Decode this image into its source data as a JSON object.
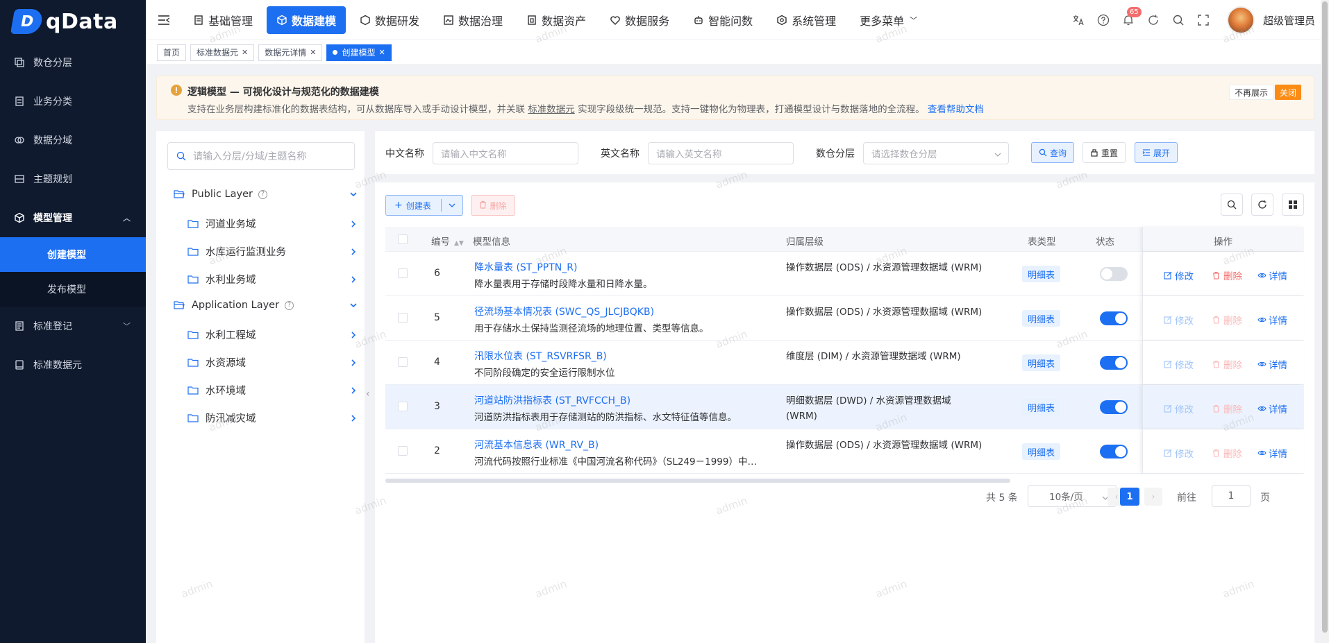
{
  "brand": {
    "logo_letter": "D",
    "name": "qData"
  },
  "sidebar": {
    "items": [
      {
        "label": "数仓分层",
        "icon": "layers-icon"
      },
      {
        "label": "业务分类",
        "icon": "list-icon"
      },
      {
        "label": "数据分域",
        "icon": "domain-icon"
      },
      {
        "label": "主题规划",
        "icon": "theme-icon"
      },
      {
        "label": "模型管理",
        "icon": "cube-icon",
        "expanded": true
      },
      {
        "label": "标准登记",
        "icon": "register-icon"
      },
      {
        "label": "标准数据元",
        "icon": "book-icon"
      }
    ],
    "subitems": [
      {
        "label": "创建模型",
        "active": true
      },
      {
        "label": "发布模型",
        "active": false
      }
    ]
  },
  "topnav": {
    "items": [
      {
        "label": "基础管理",
        "active": false
      },
      {
        "label": "数据建模",
        "active": true
      },
      {
        "label": "数据研发",
        "active": false
      },
      {
        "label": "数据治理",
        "active": false
      },
      {
        "label": "数据资产",
        "active": false
      },
      {
        "label": "数据服务",
        "active": false
      },
      {
        "label": "智能问数",
        "active": false
      },
      {
        "label": "系统管理",
        "active": false
      }
    ],
    "more_label": "更多菜单",
    "notification_count": "65",
    "username": "超级管理员"
  },
  "tabs": [
    {
      "label": "首页",
      "closable": false,
      "active": false
    },
    {
      "label": "标准数据元",
      "closable": true,
      "active": false
    },
    {
      "label": "数据元详情",
      "closable": true,
      "active": false
    },
    {
      "label": "创建模型",
      "closable": true,
      "active": true
    }
  ],
  "alert": {
    "title": "逻辑模型 — 可视化设计与规范化的数据建模",
    "desc_part1": "支持在业务层构建标准化的数据表结构，可从数据库导入或手动设计模型，并关联",
    "desc_link": "标准数据元",
    "desc_part2": "实现字段级统一规范。支持一键物化为物理表，打通模型设计与数据落地的全流程。",
    "help_link": "查看帮助文档",
    "hide_label": "不再展示",
    "close_label": "关闭"
  },
  "tree": {
    "search_placeholder": "请输入分层/分域/主题名称",
    "groups": [
      {
        "label": "Public Layer",
        "children": [
          "河道业务域",
          "水库运行监测业务",
          "水利业务域"
        ]
      },
      {
        "label": "Application Layer",
        "children": [
          "水利工程域",
          "水资源域",
          "水环境域",
          "防汛减灾域"
        ]
      }
    ]
  },
  "filters": {
    "cn_name_label": "中文名称",
    "cn_name_placeholder": "请输入中文名称",
    "en_name_label": "英文名称",
    "en_name_placeholder": "请输入英文名称",
    "layer_label": "数仓分层",
    "layer_placeholder": "请选择数仓分层",
    "query_label": "查询",
    "reset_label": "重置",
    "expand_label": "展开"
  },
  "toolbar": {
    "create_label": "创建表",
    "delete_label": "删除"
  },
  "table": {
    "headers": {
      "id": "编号",
      "info": "模型信息",
      "layer": "归属层级",
      "type": "表类型",
      "status": "状态",
      "ops": "操作"
    },
    "ops": {
      "edit": "修改",
      "delete": "删除",
      "detail": "详情"
    },
    "rows": [
      {
        "id": "6",
        "name": "降水量表 (ST_PPTN_R)",
        "desc": "降水量表用于存储时段降水量和日降水量。",
        "layer": "操作数据层 (ODS) / 水资源管理数据域 (WRM)",
        "type": "明细表",
        "status": false,
        "highlight": false
      },
      {
        "id": "5",
        "name": "径流场基本情况表 (SWC_QS_JLCJBQKB)",
        "desc": "用于存储水土保持监测径流场的地理位置、类型等信息。",
        "layer": "操作数据层 (ODS) / 水资源管理数据域 (WRM)",
        "type": "明细表",
        "status": true,
        "highlight": false
      },
      {
        "id": "4",
        "name": "汛限水位表 (ST_RSVRFSR_B)",
        "desc": "不同阶段确定的安全运行限制水位",
        "layer": "维度层 (DIM) / 水资源管理数据域 (WRM)",
        "type": "明细表",
        "status": true,
        "highlight": false
      },
      {
        "id": "3",
        "name": "河道站防洪指标表 (ST_RVFCCH_B)",
        "desc": "河道防洪指标表用于存储测站的防洪指标、水文特征值等信息。",
        "layer": "明细数据层 (DWD) / 水资源管理数据域 (WRM)",
        "type": "明细表",
        "status": true,
        "highlight": true
      },
      {
        "id": "2",
        "name": "河流基本信息表 (WR_RV_B)",
        "desc": "河流代码按照行业标准《中国河流名称代码》（SL249－1999）中…",
        "layer": "操作数据层 (ODS) / 水资源管理数据域 (WRM)",
        "type": "明细表",
        "status": true,
        "highlight": false
      }
    ]
  },
  "pagination": {
    "total_label": "共 5 条",
    "page_size": "10条/页",
    "current": "1",
    "goto_label": "前往",
    "goto_value": "1",
    "page_label": "页"
  },
  "watermark": "admin",
  "colors": {
    "primary": "#1d6ff2",
    "sidebar_bg": "#0f1a2e",
    "danger": "#f56c6c",
    "warning": "#e6a23c"
  }
}
